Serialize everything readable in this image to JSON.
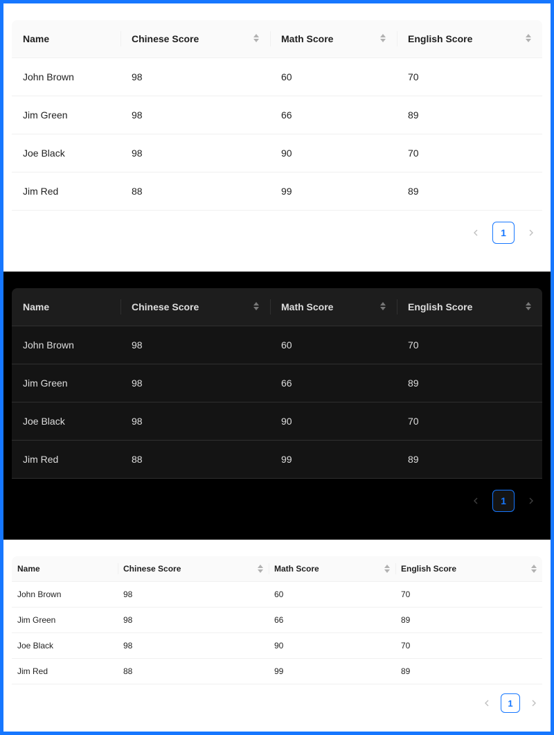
{
  "columns": [
    "Name",
    "Chinese Score",
    "Math Score",
    "English Score"
  ],
  "rows": [
    [
      "John Brown",
      "98",
      "60",
      "70"
    ],
    [
      "Jim Green",
      "98",
      "66",
      "89"
    ],
    [
      "Joe Black",
      "98",
      "90",
      "70"
    ],
    [
      "Jim Red",
      "88",
      "99",
      "89"
    ]
  ],
  "pagination": {
    "current_page": "1"
  },
  "colors": {
    "accent": "#1677ff",
    "dark_bg": "#000000",
    "dark_header": "#1d1d1d",
    "dark_row": "#141414",
    "light_header": "#fafafa"
  }
}
